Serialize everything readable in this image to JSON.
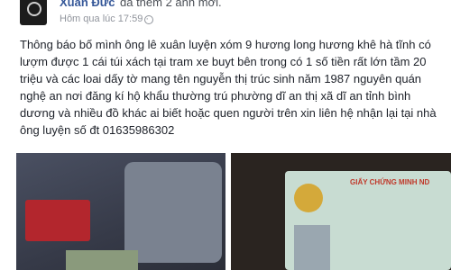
{
  "post": {
    "author": "Xuân Đức",
    "action": "đã thêm 2 ảnh mới.",
    "timestamp": "Hôm qua lúc 17:59 ·",
    "privacy_icon": "globe-icon",
    "text": "Thông báo bố mình ông lê xuân luyện xóm 9 hương long hương khê hà tĩnh có lượm được 1 cái túi xách tại tram xe buyt bên trong có 1 số tiền rất lớn tầm 20 triệu và các loai dấy tờ mang tên nguyễn thị trúc sinh năm 1987 nguyên quán nghệ an nơi đăng kí hộ khẩu thường trú phường dĩ an thị xã dĩ an tỉnh bình dương và nhiều đồ khác ai biết hoặc quen người trên xin liên hệ nhận lại tại nhà ông luyện số đt 01635986302"
  },
  "photos": {
    "id_card_title": "GIẤY CHỨNG MINH ND"
  }
}
